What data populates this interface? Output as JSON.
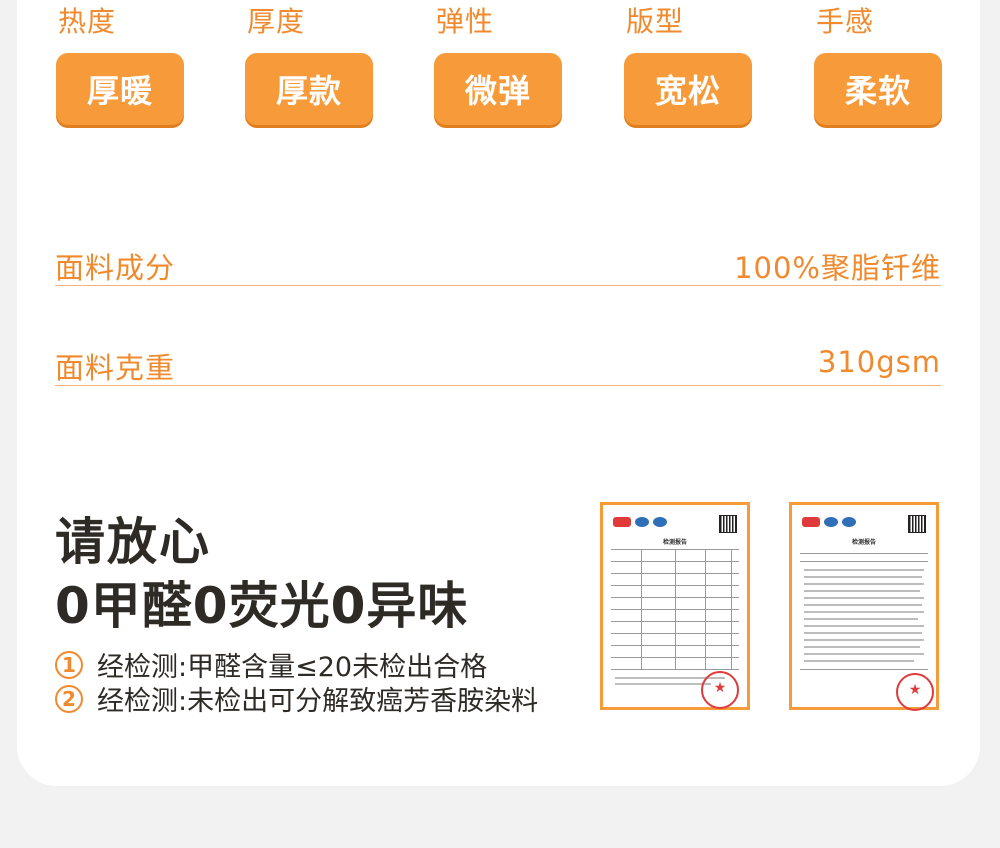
{
  "attributes": [
    {
      "label": "热度",
      "value": "厚暖"
    },
    {
      "label": "厚度",
      "value": "厚款"
    },
    {
      "label": "弹性",
      "value": "微弹"
    },
    {
      "label": "版型",
      "value": "宽松"
    },
    {
      "label": "手感",
      "value": "柔软"
    }
  ],
  "specs": [
    {
      "key": "面料成分",
      "value": "100%聚脂钎维"
    },
    {
      "key": "面料克重",
      "value": "310gsm"
    }
  ],
  "assurance": {
    "headline": "请放心",
    "subheadline": "0甲醛0荧光0异味",
    "notes": [
      {
        "num": "1",
        "text": "经检测:甲醛含量≤20未检出合格"
      },
      {
        "num": "2",
        "text": "经检测:未检出可分解致癌芳香胺染料"
      }
    ]
  },
  "reports": [
    {
      "title": "检测报告"
    },
    {
      "title": "检测报告"
    }
  ],
  "colors": {
    "accent": "#f08a2e",
    "pill": "#f79a3a",
    "text_dark": "#2e2a26",
    "stamp": "#e03a3a"
  }
}
